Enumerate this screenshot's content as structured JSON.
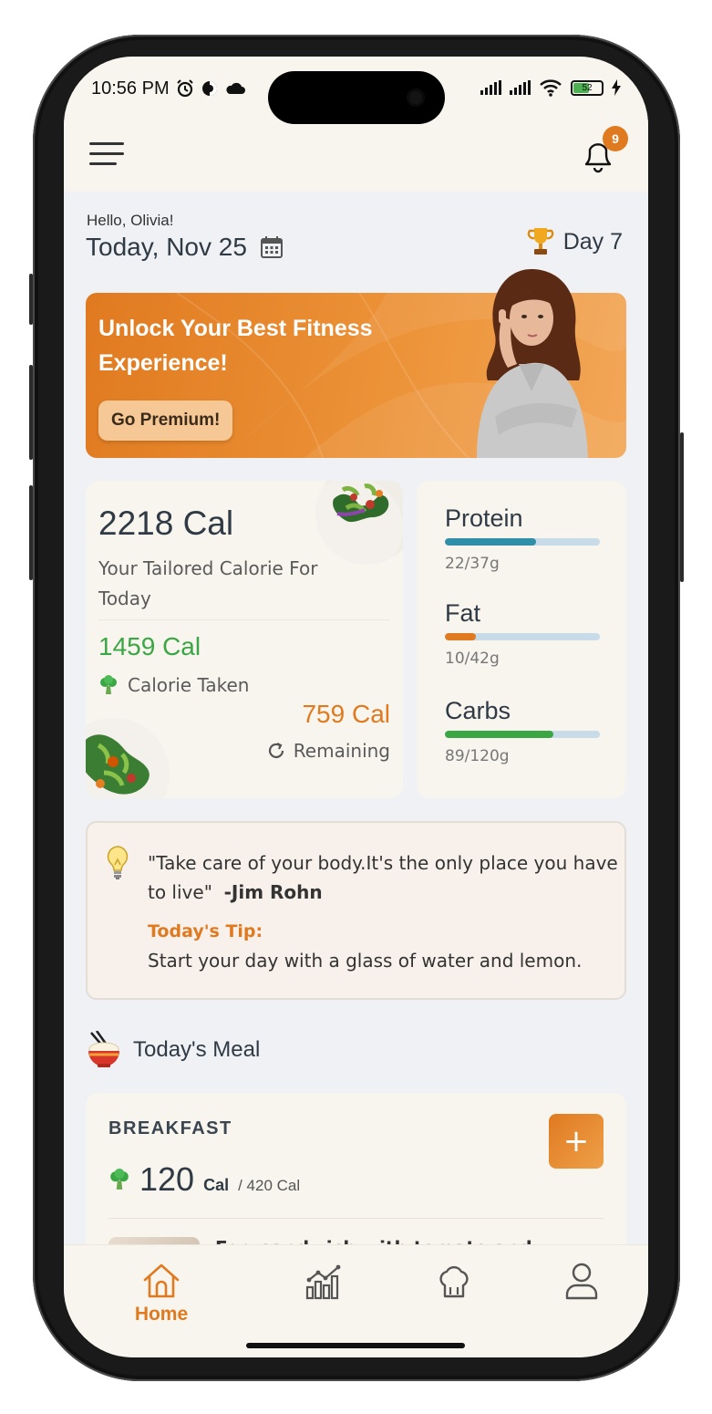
{
  "status_bar": {
    "time": "10:56 PM",
    "battery": "52"
  },
  "app_bar": {
    "notification_count": "9"
  },
  "header": {
    "greeting": "Hello, Olivia!",
    "date": "Today, Nov 25",
    "day_label": "Day 7"
  },
  "promo": {
    "title": "Unlock Your Best Fitness Experience!",
    "button_label": "Go Premium!"
  },
  "calories": {
    "total": "2218 Cal",
    "subtitle": "Your Tailored Calorie For Today",
    "taken_value": "1459 Cal",
    "taken_label": "Calorie Taken",
    "remaining_value": "759 Cal",
    "remaining_label": "Remaining"
  },
  "macros": [
    {
      "name": "Protein",
      "value": "22/37g",
      "fraction": 0.59,
      "color": "#2f8fa8"
    },
    {
      "name": "Fat",
      "value": "10/42g",
      "fraction": 0.2,
      "color": "#e07a20"
    },
    {
      "name": "Carbs",
      "value": "89/120g",
      "fraction": 0.7,
      "color": "#3ba644"
    }
  ],
  "quote": {
    "text": "\"Take care of your body.It's the only place you have to live\"",
    "author": "-Jim Rohn",
    "tip_label": "Today's Tip:",
    "tip_text": "Start your day with a glass of water and lemon."
  },
  "meals": {
    "section_title": "Today's Meal",
    "breakfast": {
      "name": "BREAKFAST",
      "add_label": "+",
      "calories": "120",
      "unit": "Cal",
      "target": "/ 420 Cal",
      "first_item": "Egg sandwich with tomato and"
    }
  },
  "tabs": [
    {
      "id": "home",
      "label": "Home",
      "icon": "home-icon",
      "active": true
    },
    {
      "id": "stats",
      "label": "",
      "icon": "chart-icon",
      "active": false
    },
    {
      "id": "recipes",
      "label": "",
      "icon": "chef-hat-icon",
      "active": false
    },
    {
      "id": "profile",
      "label": "",
      "icon": "user-icon",
      "active": false
    }
  ],
  "colors": {
    "accent": "#e07a20",
    "green": "#3ba644",
    "background": "#eff1f5",
    "card": "#f8f5ee"
  }
}
